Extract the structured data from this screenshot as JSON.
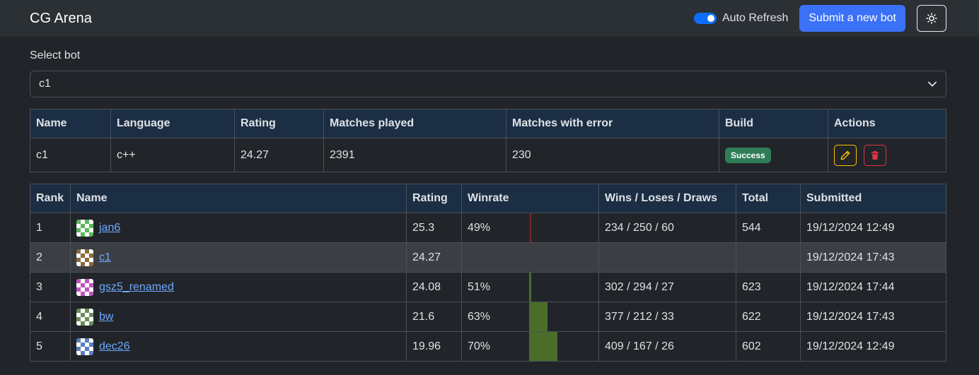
{
  "header": {
    "brand": "CG Arena",
    "auto_refresh_label": "Auto Refresh",
    "auto_refresh_on": true,
    "submit_label": "Submit a new bot",
    "theme_icon": "sun-icon"
  },
  "select": {
    "label": "Select bot",
    "value": "c1"
  },
  "bot_table": {
    "headers": [
      "Name",
      "Language",
      "Rating",
      "Matches played",
      "Matches with error",
      "Build",
      "Actions"
    ],
    "row": {
      "name": "c1",
      "language": "c++",
      "rating": "24.27",
      "matches_played": "2391",
      "matches_with_error": "230",
      "build": "Success"
    }
  },
  "rank_table": {
    "headers": [
      "Rank",
      "Name",
      "Rating",
      "Winrate",
      "Wins / Loses / Draws",
      "Total",
      "Submitted"
    ],
    "rows": [
      {
        "rank": "1",
        "name": "jan6",
        "rating": "25.3",
        "winrate": "49%",
        "winrate_value": 0.49,
        "wld": "234 / 250 / 60",
        "total": "544",
        "submitted": "19/12/2024 12:49",
        "avatar_color": "#5cb85c"
      },
      {
        "rank": "2",
        "name": "c1",
        "rating": "24.27",
        "winrate": "",
        "winrate_value": null,
        "wld": "",
        "total": "",
        "submitted": "19/12/2024 17:43",
        "avatar_color": "#8a6d3b"
      },
      {
        "rank": "3",
        "name": "gsz5_renamed",
        "rating": "24.08",
        "winrate": "51%",
        "winrate_value": 0.51,
        "wld": "302 / 294 / 27",
        "total": "623",
        "submitted": "19/12/2024 17:44",
        "avatar_color": "#c055c0"
      },
      {
        "rank": "4",
        "name": "bw",
        "rating": "21.6",
        "winrate": "63%",
        "winrate_value": 0.63,
        "wld": "377 / 212 / 33",
        "total": "622",
        "submitted": "19/12/2024 17:43",
        "avatar_color": "#6b8e5a"
      },
      {
        "rank": "5",
        "name": "dec26",
        "rating": "19.96",
        "winrate": "70%",
        "winrate_value": 0.7,
        "wld": "409 / 167 / 26",
        "total": "602",
        "submitted": "19/12/2024 12:49",
        "avatar_color": "#5a7fbf"
      }
    ]
  }
}
